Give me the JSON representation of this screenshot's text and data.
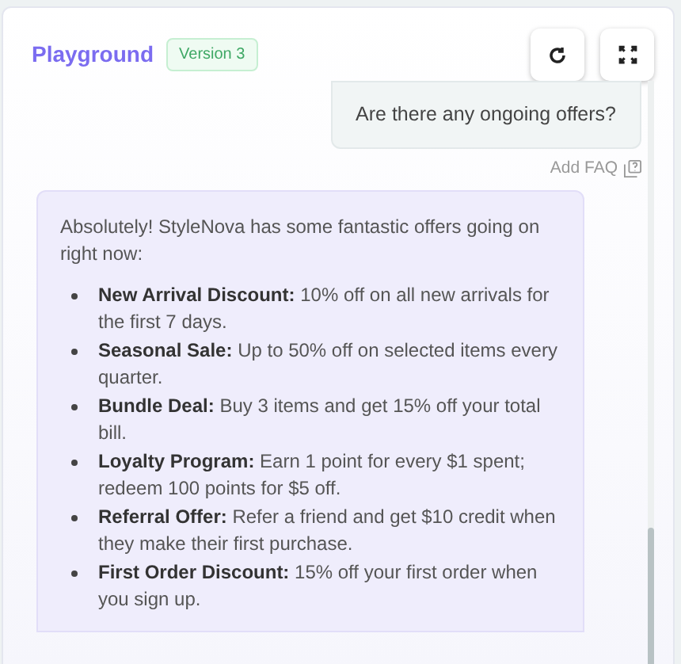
{
  "header": {
    "title": "Playground",
    "version_badge": "Version 3"
  },
  "messages": [
    {
      "kind": "user",
      "text": "Are there any ongoing offers?",
      "action": "Add FAQ"
    },
    {
      "kind": "bot",
      "intro": "Absolutely! StyleNova has some fantastic offers going on right now:",
      "items": [
        {
          "title": "New Arrival Discount:",
          "text": "10% off on all new arrivals for the first 7 days."
        },
        {
          "title": "Seasonal Sale:",
          "text": "Up to 50% off on selected items every quarter."
        },
        {
          "title": "Bundle Deal:",
          "text": "Buy 3 items and get 15% off your total bill."
        },
        {
          "title": "Loyalty Program:",
          "text": "Earn 1 point for every $1 spent; redeem 100 points for $5 off."
        },
        {
          "title": "Referral Offer:",
          "text": "Refer a friend and get $10 credit when they make their first purchase."
        },
        {
          "title": "First Order Discount:",
          "text": "15% off your first order when you sign up."
        }
      ]
    }
  ]
}
